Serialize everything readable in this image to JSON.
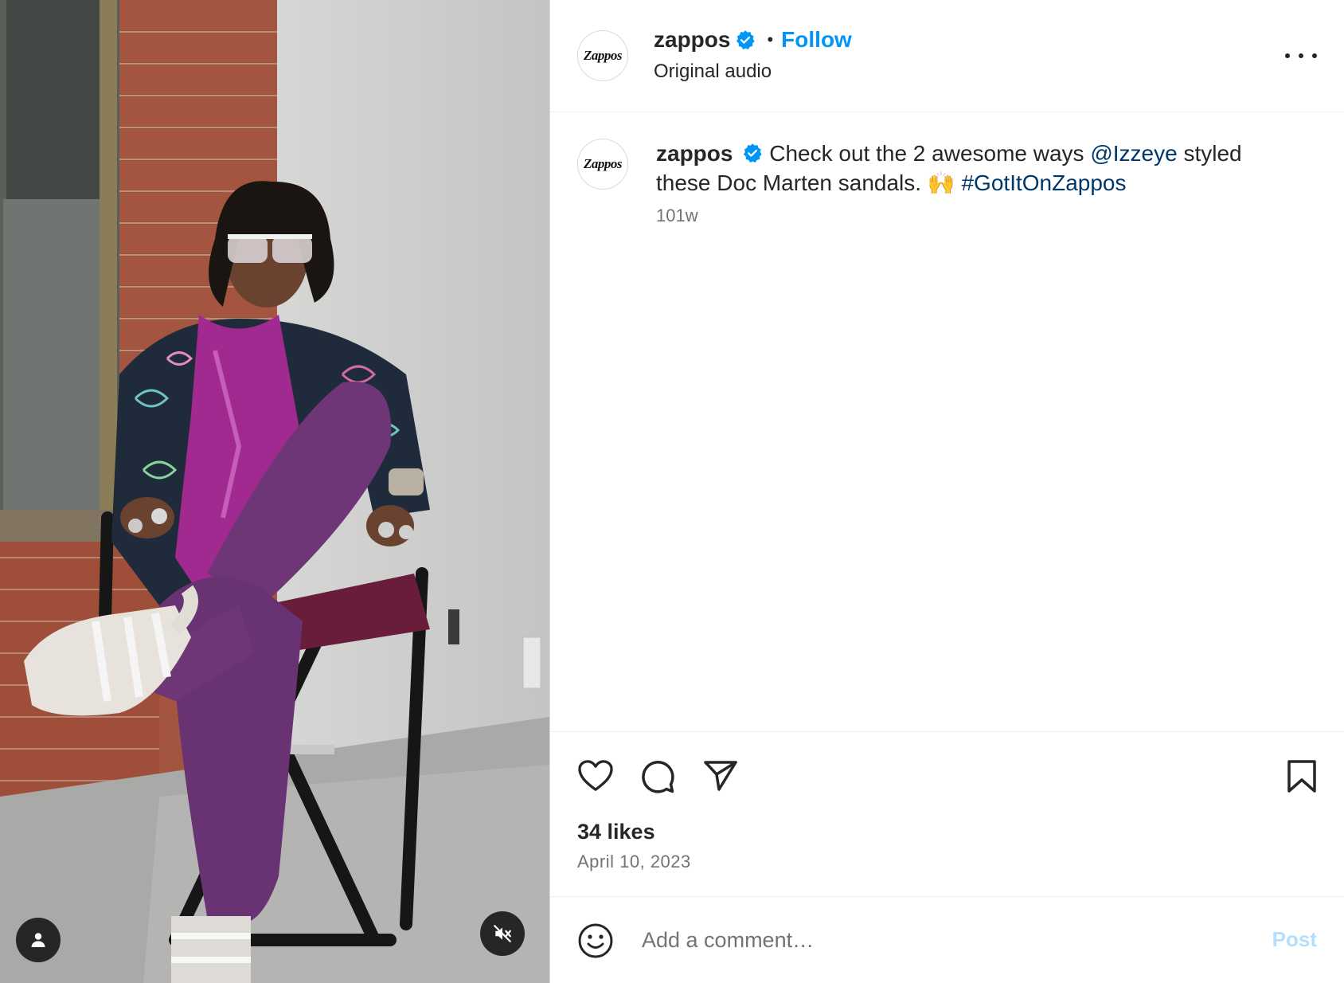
{
  "post": {
    "header": {
      "username": "zappos",
      "avatar_logo": "Zappos",
      "verified_icon": "verified-badge-icon",
      "separator": "•",
      "follow_label": "Follow",
      "subtitle": "Original audio",
      "more_icon": "more-options-icon"
    },
    "caption": {
      "username": "zappos",
      "avatar_logo": "Zappos",
      "text_before": "Check out the 2 awesome ways",
      "mention": "@Izzeye",
      "text_after": "styled these Doc Marten sandals. 🙌",
      "hashtag": "#GotItOnZappos",
      "time": "101w"
    },
    "media": {
      "type": "video",
      "tags_icon": "user-tag-icon",
      "mute_icon": "audio-muted-icon"
    },
    "actions": {
      "like_icon": "heart-icon",
      "comment_icon": "comment-icon",
      "share_icon": "share-icon",
      "save_icon": "bookmark-icon",
      "likes": "34 likes",
      "date": "April 10, 2023"
    },
    "comment_box": {
      "emoji_icon": "emoji-icon",
      "placeholder": "Add a comment…",
      "post_label": "Post"
    },
    "colors": {
      "accent": "#0095f6",
      "link": "#00376b",
      "text": "#262626",
      "secondary": "#737373",
      "post_disabled": "#b2dffc"
    }
  }
}
